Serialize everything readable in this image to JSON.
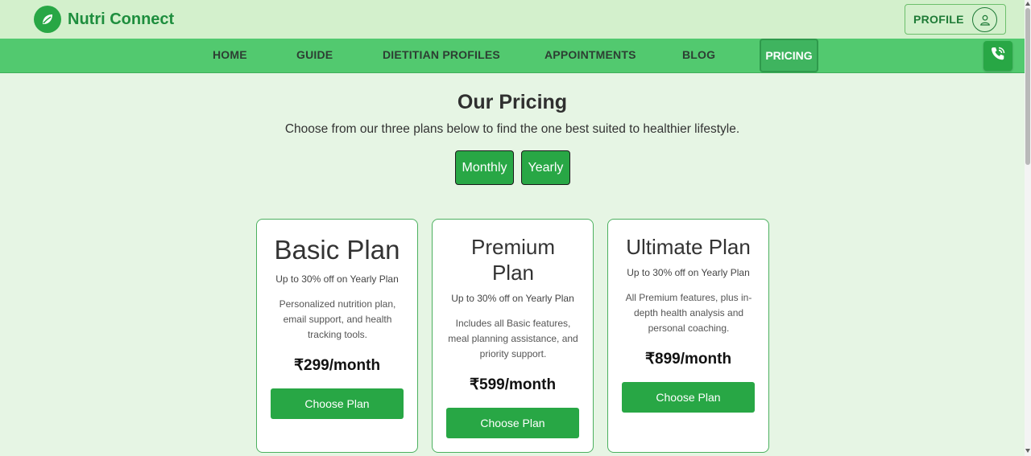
{
  "brand": {
    "logo_icon": "leaf-icon",
    "name": "Nutri Connect"
  },
  "header": {
    "profile_label": "PROFILE",
    "profile_icon": "user-icon"
  },
  "nav": {
    "items": [
      {
        "label": "HOME"
      },
      {
        "label": "GUIDE"
      },
      {
        "label": "DIETITIAN PROFILES"
      },
      {
        "label": "APPOINTMENTS"
      },
      {
        "label": "BLOG"
      },
      {
        "label": "PRICING",
        "active": true
      }
    ],
    "phone_icon": "phone-icon"
  },
  "pricing": {
    "title": "Our Pricing",
    "subtitle": "Choose from our three plans below to find the one best suited to healthier lifestyle.",
    "toggle_monthly": "Monthly",
    "toggle_yearly": "Yearly"
  },
  "plans": [
    {
      "name": "Basic Plan",
      "discount": "Up to 30% off on Yearly Plan",
      "description": "Personalized nutrition plan, email support, and health tracking tools.",
      "price": "₹299/month",
      "button": "Choose Plan"
    },
    {
      "name": "Premium Plan",
      "discount": "Up to 30% off on Yearly Plan",
      "description": "Includes all Basic features, meal planning assistance, and priority support.",
      "price": "₹599/month",
      "button": "Choose Plan"
    },
    {
      "name": "Ultimate Plan",
      "discount": "Up to 30% off on Yearly Plan",
      "description": "All Premium features, plus in-depth health analysis and personal coaching.",
      "price": "₹899/month",
      "button": "Choose Plan"
    }
  ],
  "colors": {
    "brand_green": "#28a745",
    "nav_green": "#52c96f",
    "header_bg": "#d3f0cc",
    "page_bg": "#e6f5e4"
  }
}
